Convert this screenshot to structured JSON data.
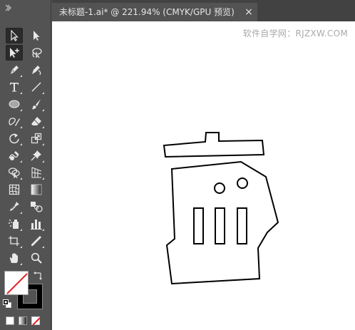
{
  "document": {
    "tab_title": "未标题-1.ai* @ 221.94% (CMYK/GPU 预览)",
    "close_glyph": "×"
  },
  "canvas": {
    "watermark": "软件自学网：RJZXW.COM",
    "background": "#ffffff"
  },
  "toolbar": {
    "background": "#535353",
    "tools": [
      {
        "name": "selection-tool",
        "icon": "arrow-outline-icon",
        "active": true
      },
      {
        "name": "direct-selection-tool",
        "icon": "arrow-filled-icon"
      },
      {
        "name": "magic-wand-tool",
        "icon": "arrow-plus-icon",
        "active": true
      },
      {
        "name": "lasso-tool",
        "icon": "lasso-icon"
      },
      {
        "name": "pen-tool",
        "icon": "pen-icon"
      },
      {
        "name": "curvature-tool",
        "icon": "curvature-pen-icon"
      },
      {
        "name": "type-tool",
        "icon": "type-icon"
      },
      {
        "name": "line-segment-tool",
        "icon": "line-icon"
      },
      {
        "name": "ellipse-tool",
        "icon": "ellipse-icon"
      },
      {
        "name": "paintbrush-tool",
        "icon": "brush-icon"
      },
      {
        "name": "shaper-tool",
        "icon": "shaper-icon"
      },
      {
        "name": "eraser-tool",
        "icon": "eraser-icon"
      },
      {
        "name": "rotate-tool",
        "icon": "rotate-icon"
      },
      {
        "name": "scale-tool",
        "icon": "scale-icon"
      },
      {
        "name": "warp-tool",
        "icon": "warp-icon"
      },
      {
        "name": "puppet-warp-tool",
        "icon": "pin-icon"
      },
      {
        "name": "shape-builder-tool",
        "icon": "shape-builder-icon"
      },
      {
        "name": "perspective-grid-tool",
        "icon": "perspective-grid-icon"
      },
      {
        "name": "mesh-tool",
        "icon": "mesh-icon"
      },
      {
        "name": "gradient-tool",
        "icon": "gradient-icon"
      },
      {
        "name": "eyedropper-tool",
        "icon": "eyedropper-icon"
      },
      {
        "name": "blend-tool",
        "icon": "blend-icon"
      },
      {
        "name": "symbol-sprayer-tool",
        "icon": "symbol-sprayer-icon"
      },
      {
        "name": "column-graph-tool",
        "icon": "column-graph-icon"
      },
      {
        "name": "artboard-tool",
        "icon": "artboard-icon"
      },
      {
        "name": "slice-tool",
        "icon": "slice-icon"
      },
      {
        "name": "hand-tool",
        "icon": "hand-icon"
      },
      {
        "name": "zoom-tool",
        "icon": "zoom-icon"
      }
    ]
  },
  "colors": {
    "fill": "#ffffff",
    "stroke": "#000000",
    "none_indicator": "#e0262a",
    "mode_buttons": [
      "color",
      "gradient",
      "none"
    ]
  }
}
